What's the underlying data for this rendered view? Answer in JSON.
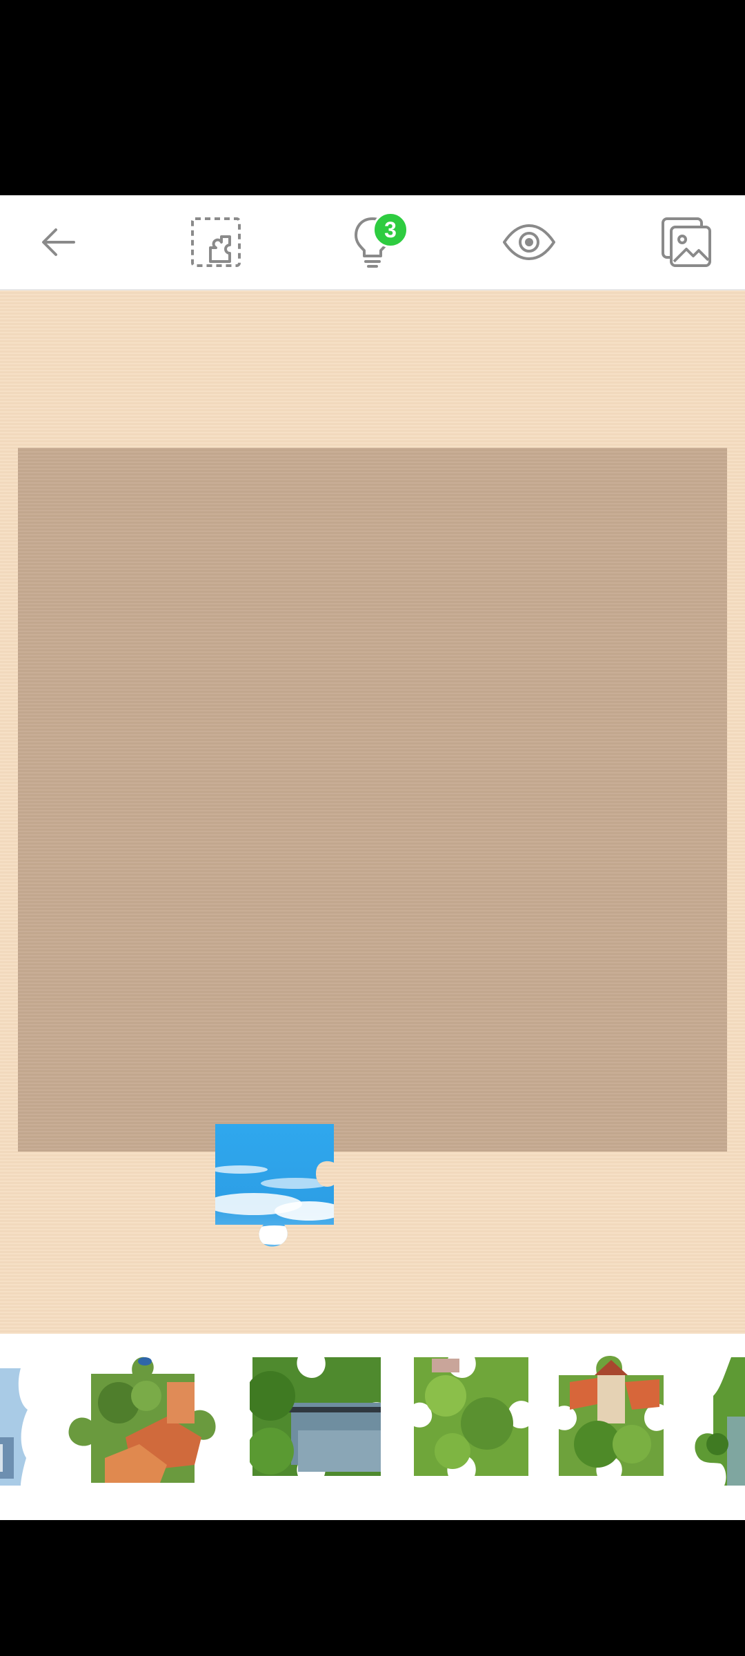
{
  "toolbar": {
    "back_icon": "arrow-left-icon",
    "select_edge_icon": "edge-pieces-icon",
    "hint_icon": "lightbulb-icon",
    "hint_count": "3",
    "preview_icon": "eye-icon",
    "background_icon": "image-gallery-icon"
  },
  "colors": {
    "table": "#f5dcc0",
    "board": "#c6aa91",
    "badge": "#2ecc40",
    "icon": "#8a8a8a"
  },
  "tray": {
    "pieces": [
      {
        "name": "tray-piece-1",
        "theme": "sky-and-tower"
      },
      {
        "name": "tray-piece-2",
        "theme": "red-rooftops-and-trees"
      },
      {
        "name": "tray-piece-3",
        "theme": "river-with-bridge"
      },
      {
        "name": "tray-piece-4",
        "theme": "green-foliage"
      },
      {
        "name": "tray-piece-5",
        "theme": "tower-and-trees"
      },
      {
        "name": "tray-piece-6",
        "theme": "green-riverbank"
      }
    ]
  },
  "board": {
    "placed_piece": "sky-with-clouds"
  }
}
